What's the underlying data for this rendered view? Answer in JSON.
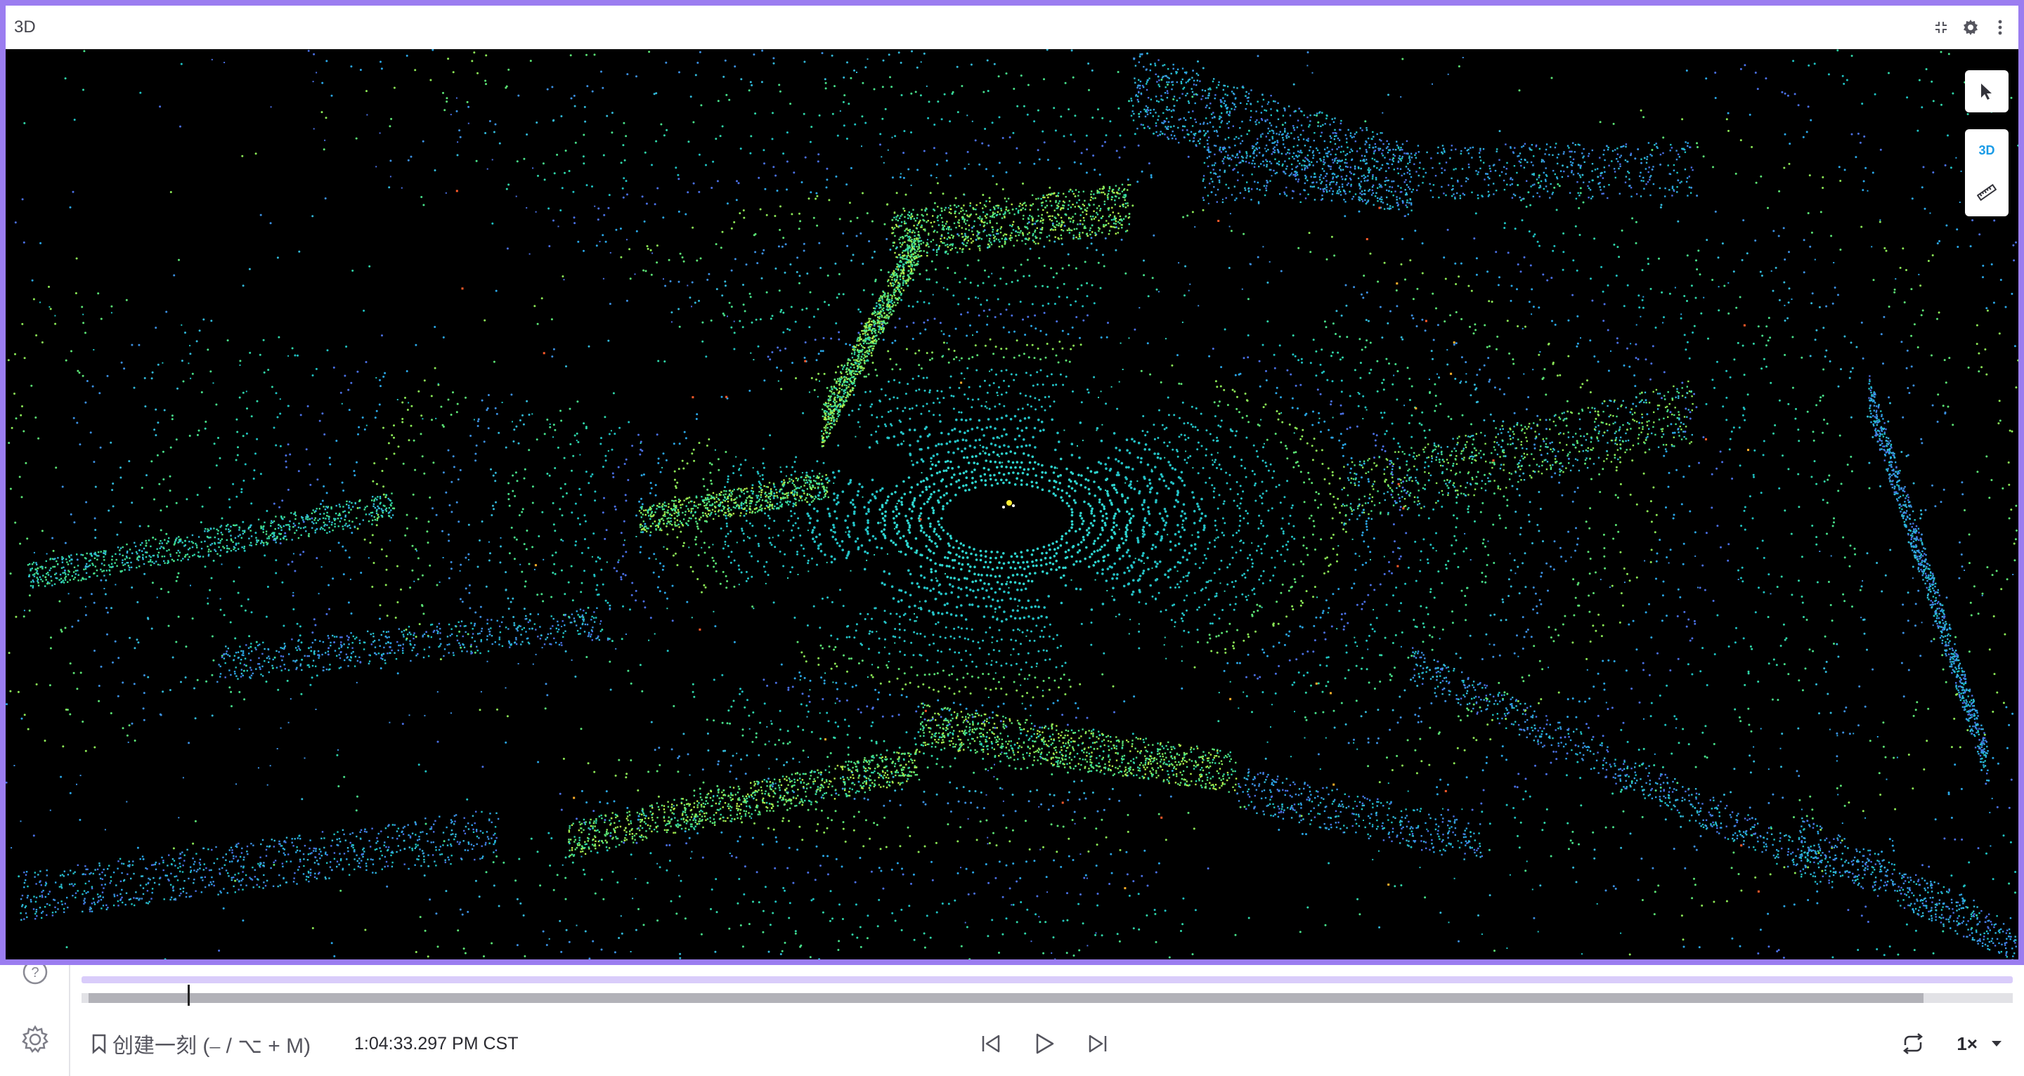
{
  "panel": {
    "title": "3D",
    "icons": [
      "collapse-icon",
      "gear-icon",
      "more-vertical-icon"
    ]
  },
  "viewport_tools": {
    "interact_icon": "cursor-icon",
    "view_mode_label": "3D",
    "measure_icon": "ruler-icon"
  },
  "sidebar": {
    "icons": [
      "help-icon",
      "gear-icon"
    ]
  },
  "playback": {
    "create_moment_label": "创建一刻 (⎯ / ⌥ + M)",
    "current_time": "1:04:33.297 PM CST",
    "speed_label": "1×",
    "loaded_fraction": 0.95,
    "position_fraction": 0.055,
    "loop_icon": "loop-icon",
    "step_back_icon": "skip-back-icon",
    "play_icon": "play-icon",
    "step_forward_icon": "skip-forward-icon",
    "speed_dropdown_icon": "chevron-down-icon"
  },
  "colors": {
    "panel_border": "#9b7df0",
    "timeline_accent": "#d9ccfa",
    "viewport_background": "#000000",
    "tool_accent": "#1a9be6"
  }
}
